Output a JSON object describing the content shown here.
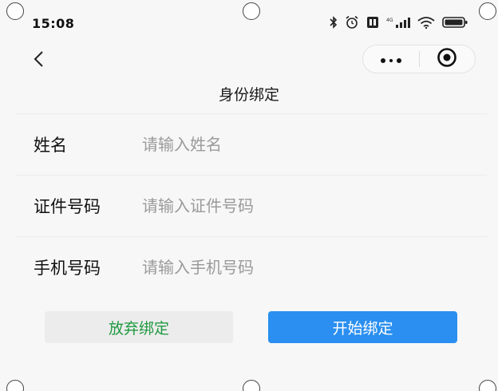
{
  "status_bar": {
    "time": "15:08",
    "icons": [
      "bluetooth-icon",
      "alarm-icon",
      "nfc-icon",
      "signal-icon",
      "wifi-icon",
      "battery-icon"
    ]
  },
  "nav": {
    "back_icon": "back-chevron-icon",
    "title": "身份绑定",
    "capsule": {
      "more_icon": "more-dots-icon",
      "close_icon": "target-circle-icon"
    }
  },
  "form": {
    "fields": [
      {
        "label": "姓名",
        "placeholder": "请输入姓名",
        "value": ""
      },
      {
        "label": "证件号码",
        "placeholder": "请输入证件号码",
        "value": ""
      },
      {
        "label": "手机号码",
        "placeholder": "请输入手机号码",
        "value": ""
      }
    ]
  },
  "actions": {
    "cancel_label": "放弃绑定",
    "start_label": "开始绑定"
  },
  "colors": {
    "background": "#f7f7f7",
    "cancel_text": "#1f9a40",
    "cancel_bg": "#ececec",
    "primary": "#2a8ff0",
    "placeholder": "#9a9a9a"
  }
}
